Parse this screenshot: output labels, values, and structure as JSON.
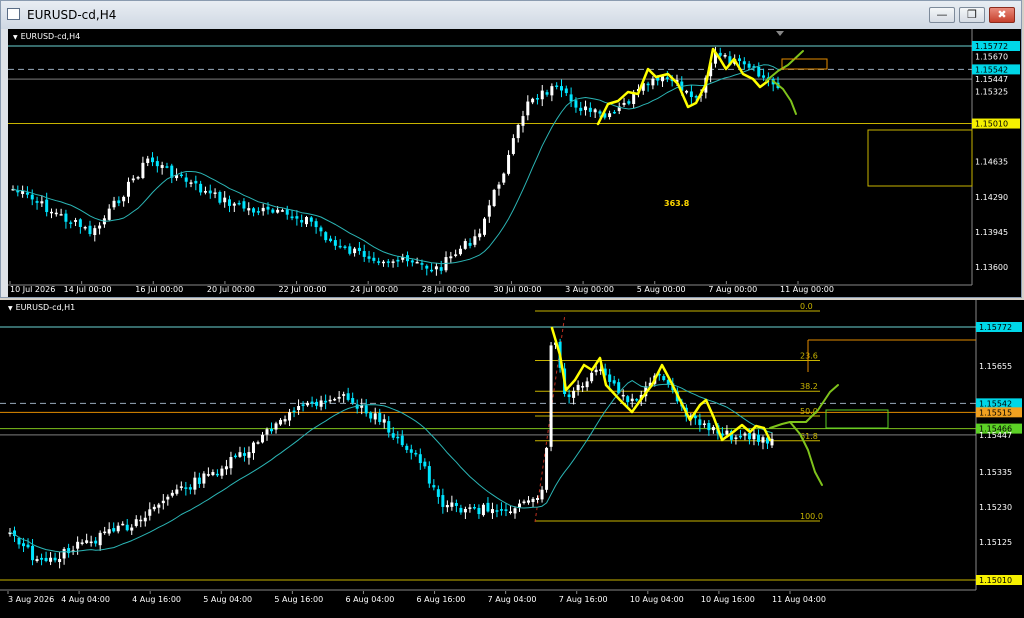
{
  "window": {
    "title": "EURUSD-cd,H4",
    "buttons": [
      "minimize",
      "restore",
      "close"
    ]
  },
  "colors": {
    "bg": "#000000",
    "candle": "#ffffff",
    "candle_alt": "#00e5ff",
    "ma": "#2bb5b5",
    "level": "#6cd3d3",
    "gold": "#c8b400",
    "yellow_draw": "#ffff00",
    "green_draw": "#7fc31c",
    "orange": "#e38b00",
    "scale_text": "#ffffff"
  },
  "h4": {
    "symbol_label": "EURUSD-cd,H4",
    "price_labels": [
      {
        "text": "1.15772",
        "price": 1.15772,
        "style": "cyan"
      },
      {
        "text": "1.15670",
        "price": 1.1567,
        "style": "plain"
      },
      {
        "text": "1.15542",
        "price": 1.15542,
        "style": "cyan"
      },
      {
        "text": "1.15447",
        "price": 1.15447,
        "style": "plain"
      },
      {
        "text": "1.15325",
        "price": 1.15325,
        "style": "plain"
      },
      {
        "text": "1.15010",
        "price": 1.1501,
        "style": "yellow"
      },
      {
        "text": "1.14635",
        "price": 1.14635,
        "style": "plain"
      },
      {
        "text": "1.14290",
        "price": 1.1429,
        "style": "plain"
      },
      {
        "text": "1.13945",
        "price": 1.13945,
        "style": "plain"
      },
      {
        "text": "1.13600",
        "price": 1.136,
        "style": "plain"
      }
    ],
    "time_labels": [
      "10 Jul 2026",
      "14 Jul 00:00",
      "16 Jul 00:00",
      "20 Jul 00:00",
      "22 Jul 00:00",
      "24 Jul 00:00",
      "28 Jul 00:00",
      "30 Jul 00:00",
      "3 Aug 00:00",
      "5 Aug 00:00",
      "7 Aug 00:00",
      "11 Aug 00:00"
    ],
    "annotation": "363.8"
  },
  "h1": {
    "symbol_label": "EURUSD-cd,H1",
    "price_labels": [
      {
        "text": "1.15772",
        "price": 1.15772,
        "style": "cyan"
      },
      {
        "text": "1.15655",
        "price": 1.15655,
        "style": "plain"
      },
      {
        "text": "1.15542",
        "price": 1.15542,
        "style": "cyan"
      },
      {
        "text": "1.15515",
        "price": 1.15515,
        "style": "orange"
      },
      {
        "text": "1.15466",
        "price": 1.15466,
        "style": "green"
      },
      {
        "text": "1.15447",
        "price": 1.15447,
        "style": "plain"
      },
      {
        "text": "1.15335",
        "price": 1.15335,
        "style": "plain"
      },
      {
        "text": "1.15230",
        "price": 1.1523,
        "style": "plain"
      },
      {
        "text": "1.15125",
        "price": 1.15125,
        "style": "plain"
      },
      {
        "text": "1.15010",
        "price": 1.1501,
        "style": "yellow"
      }
    ],
    "time_labels": [
      "3 Aug 2026",
      "4 Aug 04:00",
      "4 Aug 16:00",
      "5 Aug 04:00",
      "5 Aug 16:00",
      "6 Aug 04:00",
      "6 Aug 16:00",
      "7 Aug 04:00",
      "7 Aug 16:00",
      "10 Aug 04:00",
      "10 Aug 16:00",
      "11 Aug 04:00"
    ],
    "fib_levels": [
      {
        "label": "0.0",
        "ratio": 0.0
      },
      {
        "label": "23.6",
        "ratio": 0.236
      },
      {
        "label": "38.2",
        "ratio": 0.382
      },
      {
        "label": "50.0",
        "ratio": 0.5
      },
      {
        "label": "61.8",
        "ratio": 0.618
      },
      {
        "label": "100.0",
        "ratio": 1.0
      }
    ]
  }
}
